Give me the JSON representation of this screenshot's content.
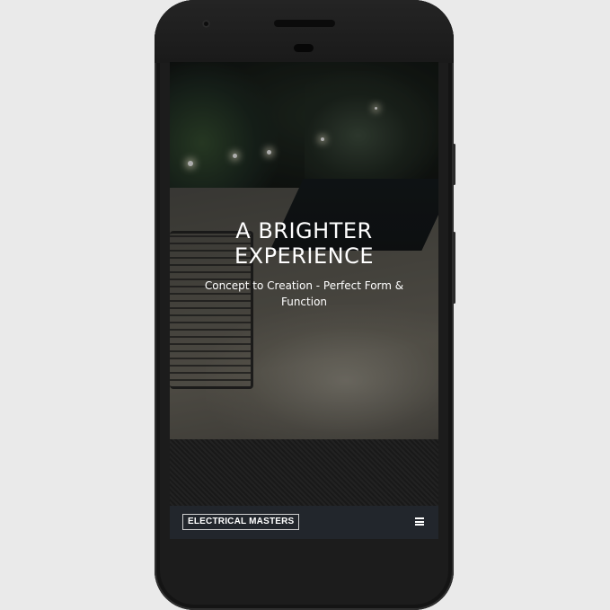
{
  "hero": {
    "title_line1": "A BRIGHTER",
    "title_line2": "EXPERIENCE",
    "subtitle": "Concept to Creation - Perfect Form & Function"
  },
  "navbar": {
    "brand": "ELECTRICAL MASTERS",
    "menu_icon": "hamburger-menu-icon"
  },
  "colors": {
    "navbar_bg": "#22262c",
    "phone_body": "#1c1c1c",
    "page_bg": "#eaeaea"
  }
}
